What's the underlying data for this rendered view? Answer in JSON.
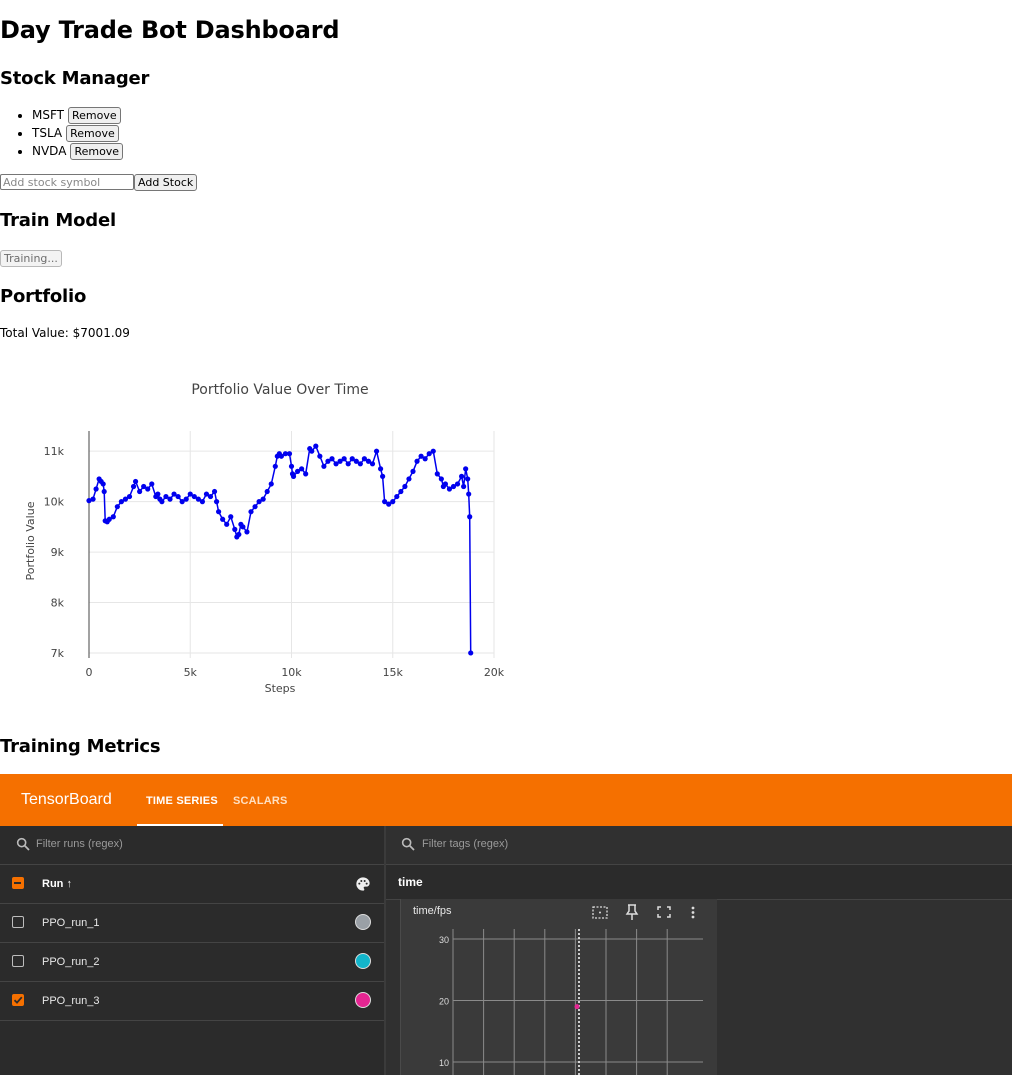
{
  "page": {
    "title": "Day Trade Bot Dashboard"
  },
  "stock_manager": {
    "heading": "Stock Manager",
    "stocks": [
      {
        "symbol": "MSFT",
        "remove_label": "Remove"
      },
      {
        "symbol": "TSLA",
        "remove_label": "Remove"
      },
      {
        "symbol": "NVDA",
        "remove_label": "Remove"
      }
    ],
    "input_placeholder": "Add stock symbol",
    "add_label": "Add Stock"
  },
  "train_model": {
    "heading": "Train Model",
    "button_label": "Training..."
  },
  "portfolio": {
    "heading": "Portfolio",
    "total_value_text": "Total Value: $7001.09"
  },
  "chart_data": {
    "type": "line",
    "title": "Portfolio Value Over Time",
    "xlabel": "Steps",
    "ylabel": "Portfolio Value",
    "xlim": [
      0,
      20000
    ],
    "ylim": [
      6900,
      11400
    ],
    "x_ticks": [
      0,
      5000,
      10000,
      15000,
      20000
    ],
    "x_tick_labels": [
      "0",
      "5k",
      "10k",
      "15k",
      "20k"
    ],
    "y_ticks": [
      7000,
      8000,
      9000,
      10000,
      11000
    ],
    "y_tick_labels": [
      "7k",
      "8k",
      "9k",
      "10k",
      "11k"
    ],
    "grid": true,
    "series": [
      {
        "color": "#0000ee",
        "x": [
          0,
          200,
          350,
          500,
          600,
          700,
          750,
          800,
          900,
          1000,
          1200,
          1400,
          1600,
          1800,
          2000,
          2200,
          2300,
          2500,
          2700,
          2900,
          3100,
          3300,
          3400,
          3500,
          3600,
          3800,
          4000,
          4200,
          4400,
          4600,
          4800,
          5000,
          5200,
          5400,
          5600,
          5800,
          6000,
          6200,
          6300,
          6400,
          6600,
          6800,
          7000,
          7200,
          7300,
          7400,
          7500,
          7600,
          7800,
          8000,
          8200,
          8400,
          8600,
          8800,
          9000,
          9200,
          9300,
          9400,
          9500,
          9700,
          9900,
          10000,
          10050,
          10100,
          10300,
          10500,
          10700,
          10900,
          11000,
          11200,
          11400,
          11600,
          11800,
          12000,
          12200,
          12400,
          12600,
          12800,
          13000,
          13200,
          13400,
          13600,
          13800,
          14000,
          14200,
          14400,
          14500,
          14600,
          14800,
          15000,
          15200,
          15400,
          15600,
          15800,
          16000,
          16200,
          16400,
          16600,
          16800,
          17000,
          17200,
          17400,
          17500,
          17600,
          17800,
          18000,
          18200,
          18400,
          18500,
          18600,
          18700,
          18750,
          18800,
          18850
        ],
        "y": [
          10020,
          10050,
          10250,
          10450,
          10400,
          10350,
          10200,
          9620,
          9600,
          9650,
          9700,
          9900,
          10000,
          10050,
          10100,
          10300,
          10400,
          10200,
          10300,
          10250,
          10350,
          10100,
          10150,
          10050,
          10000,
          10100,
          10050,
          10150,
          10100,
          10000,
          10050,
          10150,
          10100,
          10050,
          10000,
          10150,
          10100,
          10200,
          10000,
          9800,
          9650,
          9550,
          9700,
          9450,
          9300,
          9350,
          9550,
          9500,
          9400,
          9800,
          9900,
          10000,
          10050,
          10200,
          10350,
          10700,
          10900,
          10950,
          10900,
          10950,
          10950,
          10700,
          10550,
          10500,
          10600,
          10650,
          10550,
          11050,
          11000,
          11100,
          10900,
          10700,
          10800,
          10850,
          10750,
          10800,
          10850,
          10750,
          10850,
          10800,
          10750,
          10850,
          10800,
          10750,
          11000,
          10650,
          10500,
          10000,
          9950,
          10000,
          10100,
          10200,
          10300,
          10450,
          10600,
          10800,
          10900,
          10850,
          10950,
          11000,
          10550,
          10450,
          10300,
          10350,
          10250,
          10300,
          10350,
          10500,
          10300,
          10650,
          10450,
          10150,
          9700,
          7000
        ]
      }
    ]
  },
  "training_metrics": {
    "heading": "Training Metrics"
  },
  "tensorboard": {
    "brand": "TensorBoard",
    "tabs": [
      {
        "label": "TIME SERIES",
        "active": true
      },
      {
        "label": "SCALARS",
        "active": false
      }
    ],
    "runs_filter_placeholder": "Filter runs (regex)",
    "tags_filter_placeholder": "Filter tags (regex)",
    "run_header": "Run ↑",
    "runs": [
      {
        "name": "PPO_run_1",
        "checked": false,
        "color": "#9aa0a6"
      },
      {
        "name": "PPO_run_2",
        "checked": false,
        "color": "#12b5cb"
      },
      {
        "name": "PPO_run_3",
        "checked": true,
        "color": "#e52592"
      }
    ],
    "group_label": "time",
    "card": {
      "title": "time/fps",
      "y_tick_labels": [
        "30",
        "20",
        "10"
      ],
      "y_ticks": [
        30,
        20,
        10
      ],
      "point": {
        "run": "PPO_run_3",
        "y": 19
      }
    }
  }
}
